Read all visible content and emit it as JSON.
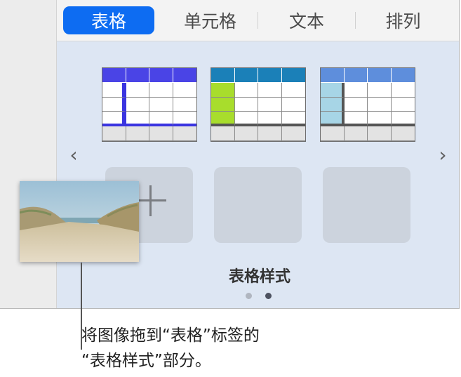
{
  "tabs": [
    {
      "label": "表格",
      "active": true
    },
    {
      "label": "单元格",
      "active": false
    },
    {
      "label": "文本",
      "active": false
    },
    {
      "label": "排列",
      "active": false
    }
  ],
  "table_styles": {
    "thumbnails": [
      {
        "name": "table-style-blue",
        "header_color": "#4a44e6",
        "accent": "#3a34e0"
      },
      {
        "name": "table-style-teal-green",
        "header_color": "#1b80b8",
        "accent": "#a8dd2c"
      },
      {
        "name": "table-style-light-blue",
        "header_color": "#5e8edc",
        "accent": "#a7d5e6"
      }
    ],
    "label": "表格样式",
    "page_count": 2,
    "current_page": 2
  },
  "navigation": {
    "prev_icon": "‹",
    "next_icon": "›"
  },
  "callout": {
    "line1": "将图像拖到“表格”标签的",
    "line2": "“表格样式”部分。"
  },
  "colors": {
    "tab_active": "#0d6cf2",
    "panel_bg": "#dde6f3"
  }
}
